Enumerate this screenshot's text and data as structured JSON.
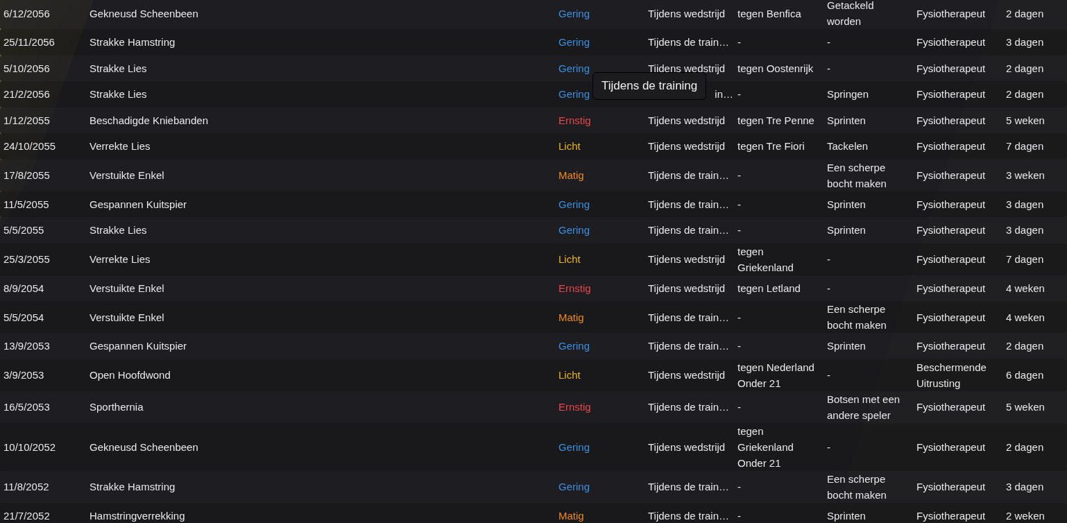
{
  "rows": [
    {
      "date": "6/12/2056",
      "injury": "Gekneusd Scheenbeen",
      "severity": "Gering",
      "color": "#3d8fe0",
      "context": "Tijdens wedstrijd",
      "opponent": "tegen Benfica",
      "cause": "Getackeld worden",
      "treatment": "Fysiotherapeut",
      "duration": "2 dagen"
    },
    {
      "date": "25/11/2056",
      "injury": "Strakke Hamstring",
      "severity": "Gering",
      "color": "#3d8fe0",
      "context": "Tijdens de train…",
      "opponent": "-",
      "cause": "-",
      "treatment": "Fysiotherapeut",
      "duration": "3 dagen"
    },
    {
      "date": "5/10/2056",
      "injury": "Strakke Lies",
      "severity": "Gering",
      "color": "#3d8fe0",
      "context": "Tijdens wedstrijd",
      "opponent": "tegen Oostenrijk",
      "cause": "-",
      "treatment": "Fysiotherapeut",
      "duration": "2 dagen"
    },
    {
      "date": "21/2/2056",
      "injury": "Strakke Lies",
      "severity": "Gering",
      "color": "#3d8fe0",
      "context": "in…",
      "covered": true,
      "opponent": "-",
      "cause": "Springen",
      "treatment": "Fysiotherapeut",
      "duration": "2 dagen"
    },
    {
      "date": "1/12/2055",
      "injury": "Beschadigde Kniebanden",
      "severity": "Ernstig",
      "color": "#e8474a",
      "context": "Tijdens wedstrijd",
      "opponent": "tegen Tre Penne",
      "cause": "Sprinten",
      "treatment": "Fysiotherapeut",
      "duration": "5 weken"
    },
    {
      "date": "24/10/2055",
      "injury": "Verrekte Lies",
      "severity": "Licht",
      "color": "#e9b52c",
      "context": "Tijdens wedstrijd",
      "opponent": "tegen Tre Fiori",
      "cause": "Tackelen",
      "treatment": "Fysiotherapeut",
      "duration": "7 dagen"
    },
    {
      "date": "17/8/2055",
      "injury": "Verstuikte Enkel",
      "severity": "Matig",
      "color": "#ef8a25",
      "context": "Tijdens de train…",
      "opponent": "-",
      "cause": "Een scherpe bocht maken",
      "treatment": "Fysiotherapeut",
      "duration": "3 weken"
    },
    {
      "date": "11/5/2055",
      "injury": "Gespannen Kuitspier",
      "severity": "Gering",
      "color": "#3d8fe0",
      "context": "Tijdens de train…",
      "opponent": "-",
      "cause": "Sprinten",
      "treatment": "Fysiotherapeut",
      "duration": "3 dagen"
    },
    {
      "date": "5/5/2055",
      "injury": "Strakke Lies",
      "severity": "Gering",
      "color": "#3d8fe0",
      "context": "Tijdens de train…",
      "opponent": "-",
      "cause": "Sprinten",
      "treatment": "Fysiotherapeut",
      "duration": "3 dagen"
    },
    {
      "date": "25/3/2055",
      "injury": "Verrekte Lies",
      "severity": "Licht",
      "color": "#e9b52c",
      "context": "Tijdens wedstrijd",
      "opponent": "tegen Griekenland",
      "cause": "-",
      "treatment": "Fysiotherapeut",
      "duration": "7 dagen"
    },
    {
      "date": "8/9/2054",
      "injury": "Verstuikte Enkel",
      "severity": "Ernstig",
      "color": "#e8474a",
      "context": "Tijdens wedstrijd",
      "opponent": "tegen Letland",
      "cause": "-",
      "treatment": "Fysiotherapeut",
      "duration": "4 weken"
    },
    {
      "date": "5/5/2054",
      "injury": "Verstuikte Enkel",
      "severity": "Matig",
      "color": "#ef8a25",
      "context": "Tijdens de train…",
      "opponent": "-",
      "cause": "Een scherpe bocht maken",
      "treatment": "Fysiotherapeut",
      "duration": "4 weken"
    },
    {
      "date": "13/9/2053",
      "injury": "Gespannen Kuitspier",
      "severity": "Gering",
      "color": "#3d8fe0",
      "context": "Tijdens de train…",
      "opponent": "-",
      "cause": "Sprinten",
      "treatment": "Fysiotherapeut",
      "duration": "2 dagen"
    },
    {
      "date": "3/9/2053",
      "injury": "Open Hoofdwond",
      "severity": "Licht",
      "color": "#e9b52c",
      "context": "Tijdens wedstrijd",
      "opponent": "tegen Nederland Onder 21",
      "cause": "-",
      "treatment": "Beschermende Uitrusting",
      "duration": "6 dagen"
    },
    {
      "date": "16/5/2053",
      "injury": "Sporthernia",
      "severity": "Ernstig",
      "color": "#e8474a",
      "context": "Tijdens de train…",
      "opponent": "-",
      "cause": "Botsen met een andere speler",
      "treatment": "Fysiotherapeut",
      "duration": "5 weken"
    },
    {
      "date": "10/10/2052",
      "injury": "Gekneusd Scheenbeen",
      "severity": "Gering",
      "color": "#3d8fe0",
      "context": "Tijdens wedstrijd",
      "opponent": "tegen Griekenland Onder 21",
      "cause": "-",
      "treatment": "Fysiotherapeut",
      "duration": "2 dagen"
    },
    {
      "date": "11/8/2052",
      "injury": "Strakke Hamstring",
      "severity": "Gering",
      "color": "#3d8fe0",
      "context": "Tijdens de train…",
      "opponent": "-",
      "cause": "Een scherpe bocht maken",
      "treatment": "Fysiotherapeut",
      "duration": "3 dagen"
    },
    {
      "date": "21/7/2052",
      "injury": "Hamstringverrekking",
      "severity": "Matig",
      "color": "#ef8a25",
      "context": "Tijdens de train…",
      "opponent": "-",
      "cause": "Sprinten",
      "treatment": "Fysiotherapeut",
      "duration": "2 weken"
    }
  ],
  "tooltip": {
    "text": "Tijdens de training"
  }
}
